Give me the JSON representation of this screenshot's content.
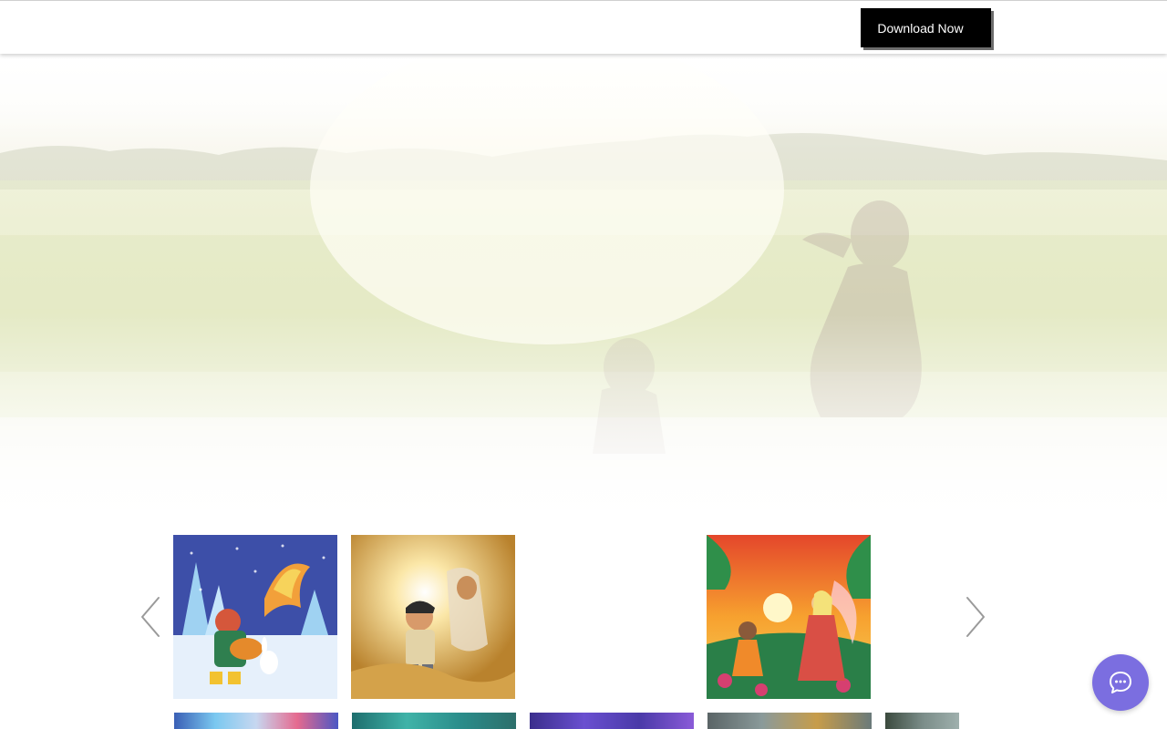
{
  "header": {
    "download_label": "Download Now"
  },
  "hero": {
    "background_color": "#eef0d6"
  },
  "gallery": {
    "items": [
      {
        "icon": "winter-musician-phoenix-image"
      },
      {
        "icon": "glowing-boy-desert-spirit-image"
      },
      {
        "icon": "empty-slot"
      },
      {
        "icon": "girl-and-fairy-sunset-image"
      }
    ],
    "second_row": [
      {
        "icon": "rainbow-hall-image"
      },
      {
        "icon": "teal-palace-image"
      },
      {
        "icon": "crystal-cave-image"
      },
      {
        "icon": "lantern-street-image"
      },
      {
        "icon": "city-building-image"
      }
    ]
  },
  "chat": {
    "icon": "chat-bubble-icon",
    "color": "#7b6ee0"
  }
}
